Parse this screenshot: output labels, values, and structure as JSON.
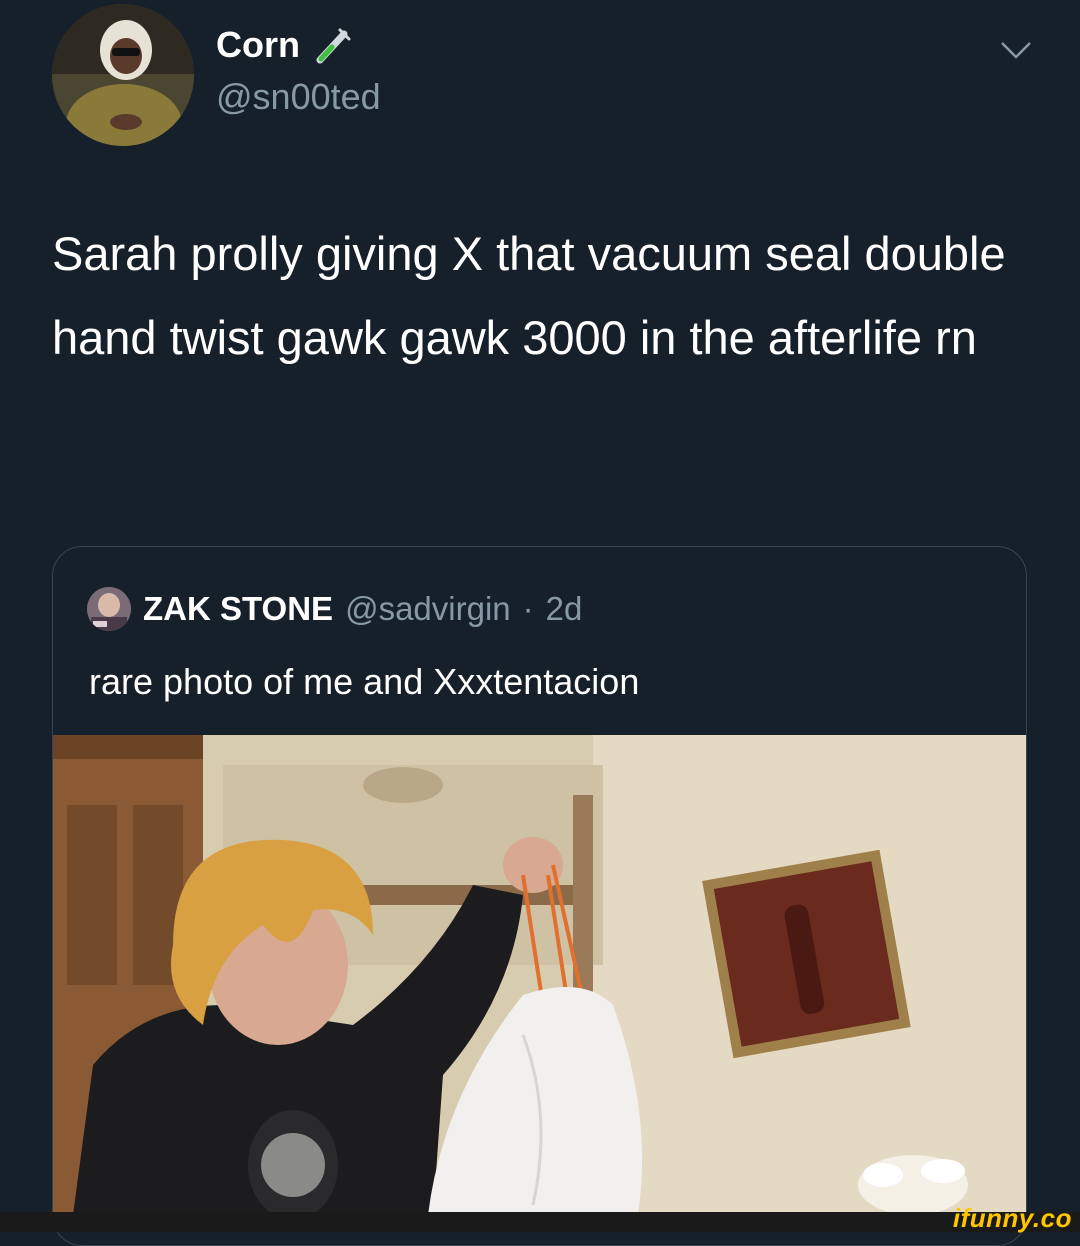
{
  "author": {
    "display_name": "Corn",
    "name_emoji": "test-tube-emoji",
    "handle": "@sn00ted"
  },
  "tweet": {
    "text": "Sarah prolly giving X that vacuum seal double hand twist gawk gawk 3000 in the afterlife rn"
  },
  "quoted_tweet": {
    "display_name": "ZAK STONE",
    "handle": "@sadvirgin",
    "separator": "·",
    "time": "2d",
    "text": "rare photo of me and Xxxtentacion"
  },
  "watermark": "ifunny.co",
  "icons": {
    "menu": "chevron-down-icon"
  },
  "colors": {
    "background": "#15202b",
    "secondary_text": "#8899a6",
    "border": "#38444d",
    "watermark": "#ffc600"
  }
}
